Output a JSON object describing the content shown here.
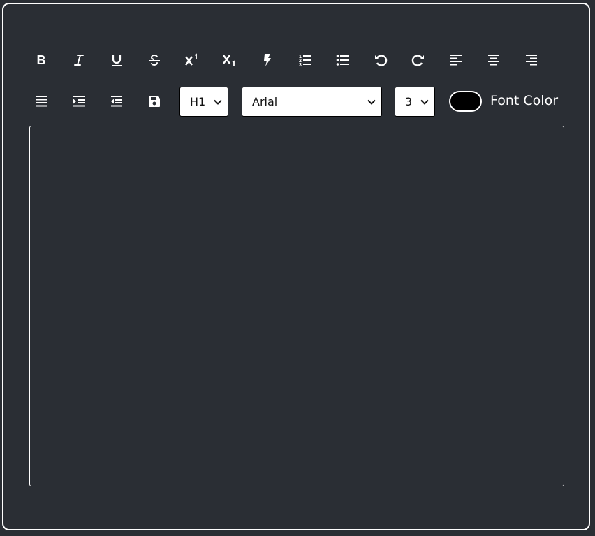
{
  "toolbar": {
    "row1": [
      {
        "name": "bold-button",
        "icon": "bold-icon"
      },
      {
        "name": "italic-button",
        "icon": "italic-icon"
      },
      {
        "name": "underline-button",
        "icon": "underline-icon"
      },
      {
        "name": "strikethrough-button",
        "icon": "strikethrough-icon"
      },
      {
        "name": "superscript-button",
        "icon": "superscript-icon"
      },
      {
        "name": "subscript-button",
        "icon": "subscript-icon"
      },
      {
        "name": "create-link-button",
        "icon": "bolt-icon"
      },
      {
        "name": "ordered-list-button",
        "icon": "ordered-list-icon"
      },
      {
        "name": "unordered-list-button",
        "icon": "unordered-list-icon"
      },
      {
        "name": "undo-button",
        "icon": "undo-icon"
      },
      {
        "name": "redo-button",
        "icon": "redo-icon"
      },
      {
        "name": "align-left-button",
        "icon": "align-left-icon"
      },
      {
        "name": "align-center-button",
        "icon": "align-center-icon"
      },
      {
        "name": "align-right-button",
        "icon": "align-right-icon"
      }
    ],
    "row2": [
      {
        "name": "justify-button",
        "icon": "align-justify-icon"
      },
      {
        "name": "indent-button",
        "icon": "indent-icon"
      },
      {
        "name": "outdent-button",
        "icon": "outdent-icon"
      },
      {
        "name": "save-button",
        "icon": "save-icon"
      }
    ],
    "heading_select": {
      "value": "H1"
    },
    "font_select": {
      "value": "Arial"
    },
    "size_select": {
      "value": "3"
    },
    "font_color": {
      "label": "Font Color",
      "value": "#000000"
    }
  },
  "colors": {
    "background": "#2a2e34",
    "border": "#ffffff",
    "icon": "#ffffff"
  }
}
